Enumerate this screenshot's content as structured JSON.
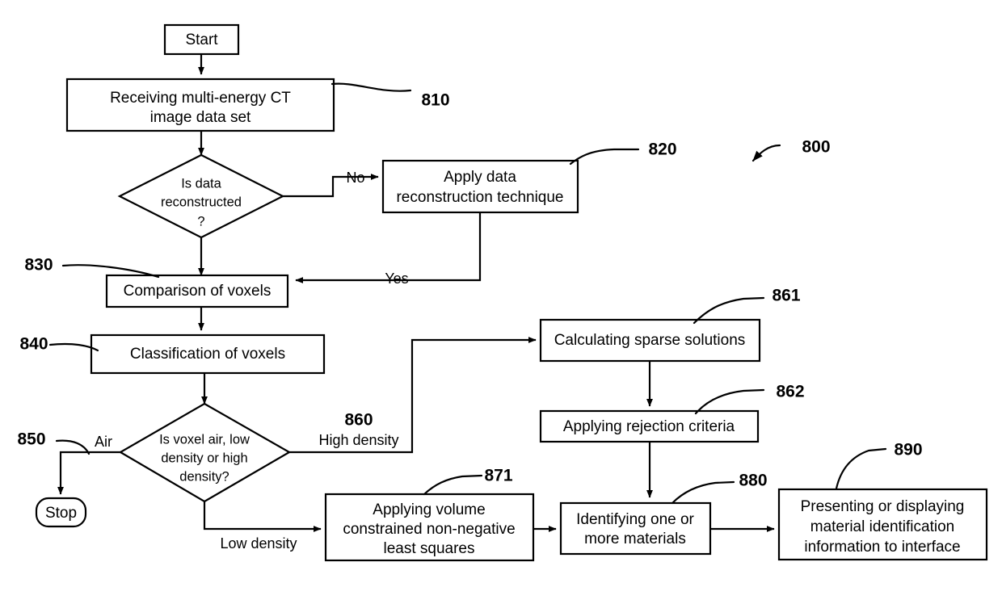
{
  "diagram": {
    "type": "flowchart",
    "figure_ref": "800",
    "nodes": [
      {
        "id": "start",
        "ref": "",
        "shape": "rect",
        "lines": [
          "Start"
        ]
      },
      {
        "id": "receiving",
        "ref": "810",
        "shape": "rect",
        "lines": [
          "Receiving multi-energy CT",
          "image data set"
        ]
      },
      {
        "id": "is_recon",
        "ref": "",
        "shape": "diamond",
        "lines": [
          "Is data",
          "reconstructed",
          "?"
        ]
      },
      {
        "id": "apply_recon",
        "ref": "820",
        "shape": "rect",
        "lines": [
          "Apply data",
          "reconstruction technique"
        ]
      },
      {
        "id": "comparison",
        "ref": "830",
        "shape": "rect",
        "lines": [
          "Comparison of voxels"
        ]
      },
      {
        "id": "classify",
        "ref": "840",
        "shape": "rect",
        "lines": [
          "Classification of voxels"
        ]
      },
      {
        "id": "voxel_kind",
        "ref": "",
        "shape": "diamond",
        "lines": [
          "Is voxel air, low",
          "density or high",
          "density?"
        ]
      },
      {
        "id": "stop",
        "ref": "",
        "shape": "stadium",
        "lines": [
          "Stop"
        ]
      },
      {
        "id": "sparse",
        "ref": "861",
        "shape": "rect",
        "lines": [
          "Calculating sparse solutions"
        ]
      },
      {
        "id": "rejection",
        "ref": "862",
        "shape": "rect",
        "lines": [
          "Applying rejection criteria"
        ]
      },
      {
        "id": "vcnnls",
        "ref": "871",
        "shape": "rect",
        "lines": [
          "Applying volume",
          "constrained non-negative",
          "least squares"
        ]
      },
      {
        "id": "identify",
        "ref": "880",
        "shape": "rect",
        "lines": [
          "Identifying one or",
          "more materials"
        ]
      },
      {
        "id": "present",
        "ref": "890",
        "shape": "rect",
        "lines": [
          "Presenting or displaying",
          "material identification",
          "information to interface"
        ]
      }
    ],
    "edge_labels": {
      "no": "No",
      "yes": "Yes",
      "air": "Air",
      "low_density": "Low density",
      "high_density": "High density"
    },
    "reference_numerals": {
      "fig": "800",
      "receiving": "810",
      "apply_recon": "820",
      "comparison": "830",
      "classify": "840",
      "air_branch": "850",
      "high_density_branch": "860",
      "sparse": "861",
      "rejection": "862",
      "vcnnls": "871",
      "identify": "880",
      "present": "890"
    },
    "colors": {
      "stroke": "#000000",
      "fill": "#ffffff",
      "text": "#000000"
    }
  }
}
